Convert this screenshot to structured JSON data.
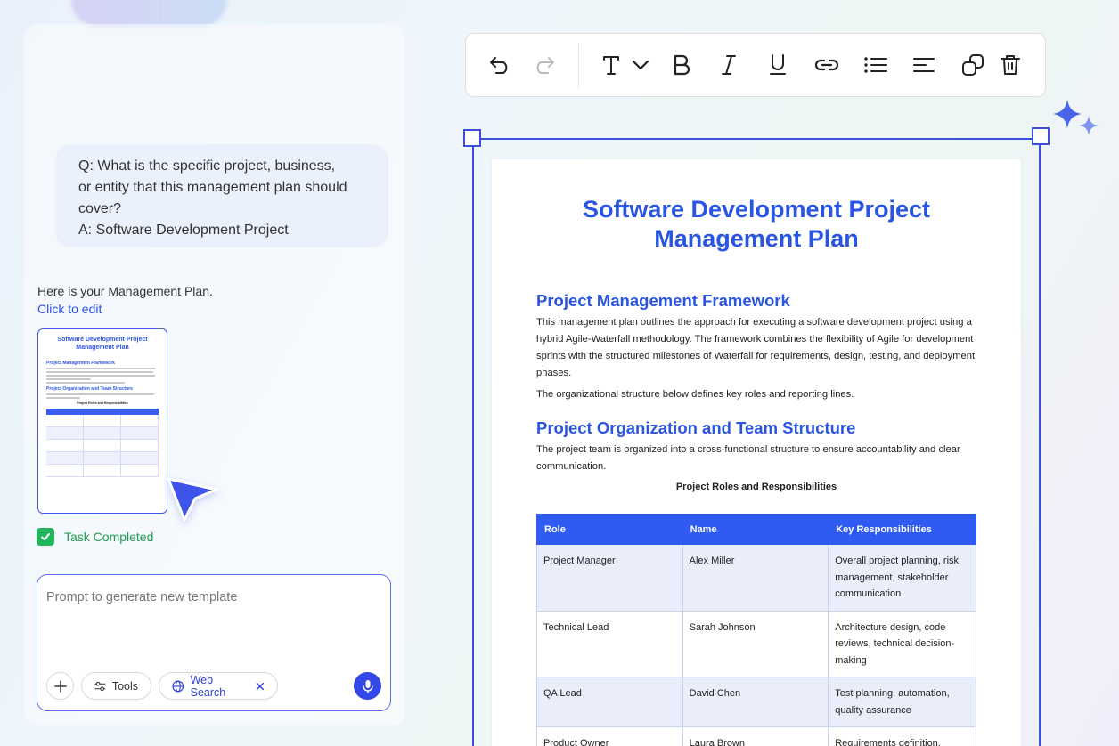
{
  "chat": {
    "question": "Q: What is the specific project, business,\nor entity that this management plan should\ncover?",
    "answer": "A: Software Development Project",
    "response": "Here is your Management Plan.",
    "edit_link": "Click to edit",
    "task_status": "Task Completed",
    "thumbnail": {
      "title": "Software Development Project Management Plan",
      "section1": "Project Management Framework",
      "section2": "Project Organization and Team Structure",
      "caption": "Project Roles and Responsibilities"
    }
  },
  "prompt": {
    "placeholder": "Prompt to generate new template",
    "tools_label": "Tools",
    "web_search_label": "Web Search"
  },
  "toolbar": {
    "icons": [
      "undo-icon",
      "redo-icon",
      "text-icon",
      "chevron-down-icon",
      "bold-icon",
      "italic-icon",
      "underline-icon",
      "link-icon",
      "list-icon",
      "align-icon",
      "duplicate-icon",
      "delete-icon"
    ]
  },
  "document": {
    "title": "Software Development Project Management Plan",
    "section1_heading": "Project Management Framework",
    "section1_para1": "This management plan outlines the approach for executing a software development project using a hybrid Agile-Waterfall methodology. The framework combines the flexibility of Agile for development sprints with the structured milestones of Waterfall for requirements, design, testing, and deployment phases.",
    "section1_para2": "The organizational structure below defines key roles and reporting lines.",
    "section2_heading": "Project Organization and Team Structure",
    "section2_para": "The project team is organized into a cross-functional structure to ensure accountability and clear communication.",
    "table_caption": "Project Roles and Responsibilities",
    "table_headers": [
      "Role",
      "Name",
      "Key Responsibilities"
    ],
    "table_rows": [
      [
        "Project Manager",
        "Alex Miller",
        "Overall project planning, risk management, stakeholder communication"
      ],
      [
        "Technical Lead",
        "Sarah Johnson",
        "Architecture design, code reviews, technical decision-making"
      ],
      [
        "QA Lead",
        "David Chen",
        "Test planning, automation, quality assurance"
      ],
      [
        "Product Owner",
        "Laura Brown",
        "Requirements definition, backlog prioritization"
      ]
    ]
  },
  "colors": {
    "accent": "#2e4fe8",
    "heading": "#2a55e2",
    "table_header": "#2f5bf2",
    "success": "#22b45d"
  }
}
